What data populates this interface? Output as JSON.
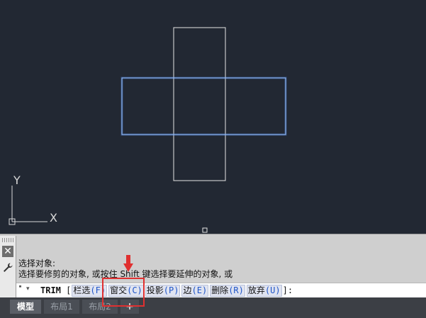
{
  "canvas": {
    "background": "#222833",
    "ucs_y_label": "Y",
    "ucs_x_label": "X"
  },
  "command_panel": {
    "history": [
      "选择对象:",
      "选择要修剪的对象, 或按住 Shift 键选择要延伸的对象, 或"
    ],
    "prefix_dots": "''''",
    "prefix_caret": "▾",
    "command_name": "TRIM",
    "open_bracket": "[",
    "options": [
      {
        "label": "栏选",
        "key": "(F)"
      },
      {
        "label": "窗交",
        "key": "(C)"
      },
      {
        "label": "投影",
        "key": "(P)"
      },
      {
        "label": "边",
        "key": "(E)"
      },
      {
        "label": "删除",
        "key": "(R)"
      },
      {
        "label": "放弃",
        "key": "(U)"
      }
    ],
    "close_bracket": "]:"
  },
  "tabs": {
    "items": [
      "模型",
      "布局1",
      "布局2"
    ],
    "add": "+"
  },
  "icons": {
    "close": "close-icon",
    "settings": "wrench-icon",
    "pointer": "red-down-arrow-icon"
  },
  "colors": {
    "selected_rect": "#4f8fff",
    "highlight": "#e03030"
  }
}
